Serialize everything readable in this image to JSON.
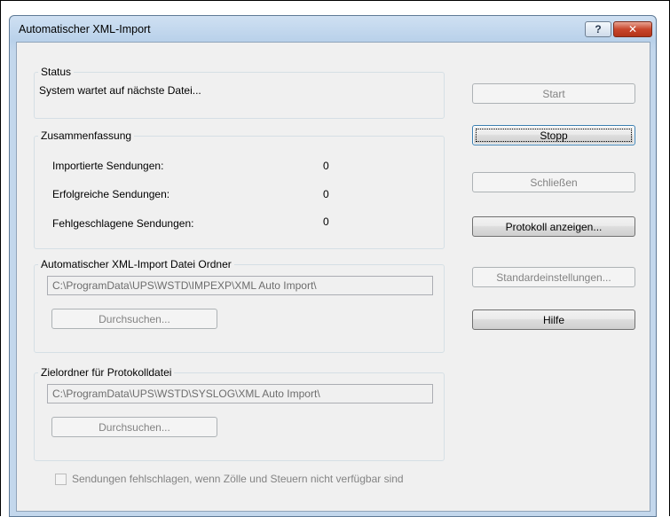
{
  "window": {
    "title": "Automatischer XML-Import",
    "help_label": "?",
    "close_label": "✕"
  },
  "status": {
    "legend": "Status",
    "text": "System wartet auf nächste Datei..."
  },
  "summary": {
    "legend": "Zusammenfassung",
    "rows": [
      {
        "label": "Importierte Sendungen:",
        "value": "0"
      },
      {
        "label": "Erfolgreiche Sendungen:",
        "value": "0"
      },
      {
        "label": "Fehlgeschlagene Sendungen:",
        "value": "0"
      }
    ]
  },
  "import_folder": {
    "legend": "Automatischer XML-Import Datei Ordner",
    "path": "C:\\ProgramData\\UPS\\WSTD\\IMPEXP\\XML Auto Import\\",
    "browse_label": "Durchsuchen..."
  },
  "log_folder": {
    "legend": "Zielordner für Protokolldatei",
    "path": "C:\\ProgramData\\UPS\\WSTD\\SYSLOG\\XML Auto Import\\",
    "browse_label": "Durchsuchen..."
  },
  "fail_checkbox": {
    "label": "Sendungen fehlschlagen, wenn Zölle und Steuern nicht verfügbar sind",
    "checked": false
  },
  "buttons": {
    "start": "Start",
    "stop": "Stopp",
    "close": "Schließen",
    "show_log": "Protokoll anzeigen...",
    "defaults": "Standardeinstellungen...",
    "help": "Hilfe"
  }
}
